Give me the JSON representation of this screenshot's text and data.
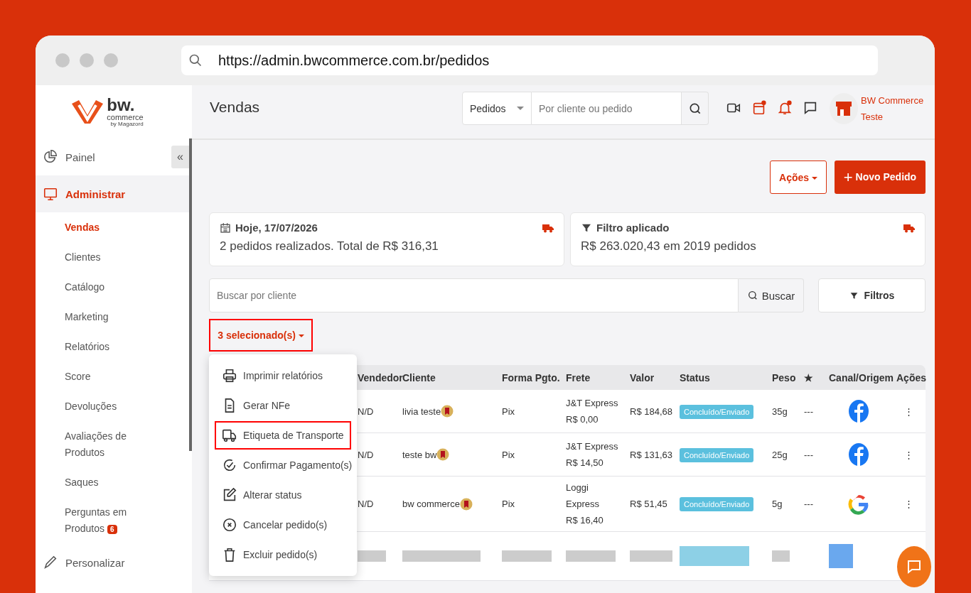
{
  "browser": {
    "url": "https://admin.bwcommerce.com.br/pedidos"
  },
  "logo": {
    "word": "bw.",
    "sub": "commerce",
    "by": "by Magazord"
  },
  "sidebar": {
    "items": [
      {
        "label": "Painel",
        "kind": "pie",
        "selected": false
      },
      {
        "label": "Administrar",
        "kind": "monitor",
        "selected": true,
        "children": [
          {
            "label": "Vendas",
            "selected": true
          },
          {
            "label": "Clientes",
            "selected": false
          },
          {
            "label": "Catálogo",
            "selected": false
          },
          {
            "label": "Marketing",
            "selected": false
          },
          {
            "label": "Relatórios",
            "selected": false
          },
          {
            "label": "Score",
            "selected": false
          },
          {
            "label": "Devoluções",
            "selected": false
          },
          {
            "label": "Avaliações de Produtos",
            "selected": false
          },
          {
            "label": "Saques",
            "selected": false
          },
          {
            "label": "Perguntas em Produtos",
            "badge": "6",
            "selected": false
          }
        ]
      },
      {
        "label": "Personalizar",
        "kind": "brush",
        "selected": false
      }
    ],
    "collapse": "«"
  },
  "header": {
    "title": "Vendas",
    "search_scope": "Pedidos",
    "search_placeholder": "Por cliente ou pedido",
    "icons": [
      {
        "kind": "video",
        "badge": false
      },
      {
        "kind": "calendar",
        "badge": true
      },
      {
        "kind": "bell",
        "badge": true
      },
      {
        "kind": "chat",
        "badge": false
      }
    ],
    "user": "BW Commerce Teste"
  },
  "actions": {
    "menu": "Ações",
    "new": "Novo Pedido",
    "new_icon": "+"
  },
  "cards": [
    {
      "kind": "calendar",
      "title": "Hoje, 17/07/2026",
      "text": "2 pedidos realizados. Total de R$ 316,31"
    },
    {
      "kind": "filter",
      "title": "Filtro aplicado",
      "text": "R$ 263.020,43 em 2019 pedidos"
    }
  ],
  "search": {
    "placeholder": "Buscar por cliente",
    "button": "Buscar",
    "filters": "Filtros"
  },
  "selection": {
    "label": "3 selecionado(s)",
    "highlighted": true
  },
  "menu": [
    {
      "label": "Imprimir relatórios",
      "kind": "printer",
      "highlighted": false
    },
    {
      "label": "Gerar NFe",
      "kind": "file",
      "highlighted": false
    },
    {
      "label": "Etiqueta de Transporte",
      "kind": "truck",
      "highlighted": true
    },
    {
      "label": "Confirmar Pagamento(s)",
      "kind": "check",
      "highlighted": false
    },
    {
      "label": "Alterar status",
      "kind": "edit",
      "highlighted": false
    },
    {
      "label": "Cancelar pedido(s)",
      "kind": "cancel",
      "highlighted": false
    },
    {
      "label": "Excluir pedido(s)",
      "kind": "trash",
      "highlighted": false
    }
  ],
  "table": {
    "columns": [
      "Vendedor",
      "Cliente",
      "Forma Pgto.",
      "Frete",
      "Valor",
      "Status",
      "Peso",
      "★",
      "Canal/Origem",
      "Ações"
    ],
    "rows": [
      {
        "seller": "N/D",
        "client": "livia teste",
        "payment": "Pix",
        "freight": [
          "J&T Express",
          "R$ 0,00"
        ],
        "value": "R$ 184,68",
        "status": "Concluído/Enviado",
        "weight": "35g",
        "rating": "---",
        "channel": {
          "kind": "facebook"
        },
        "more": "⋮"
      },
      {
        "seller": "N/D",
        "client": "teste bw",
        "payment": "Pix",
        "freight": [
          "J&T Express",
          "R$ 14,50"
        ],
        "value": "R$ 131,63",
        "status": "Concluído/Enviado",
        "weight": "25g",
        "rating": "---",
        "channel": {
          "kind": "facebook"
        },
        "more": "⋮"
      },
      {
        "seller": "N/D",
        "client": "bw commerce",
        "payment": "Pix",
        "freight": [
          "Loggi",
          "Express",
          "R$ 16,40"
        ],
        "value": "R$ 51,45",
        "status": "Concluído/Enviado",
        "weight": "5g",
        "rating": "---",
        "channel": {
          "kind": "google"
        },
        "more": "⋮"
      }
    ]
  }
}
